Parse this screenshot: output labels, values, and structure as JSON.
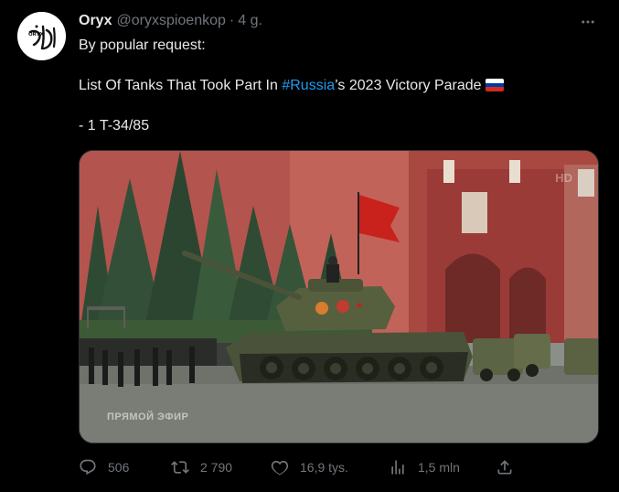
{
  "tweet": {
    "author": {
      "name": "Oryx",
      "handle": "@oryxspioenkop",
      "separator": "·",
      "time": "4 g.",
      "avatar_text": "ORYX"
    },
    "text": {
      "line1": "By popular request:",
      "line2_prefix": "List Of Tanks That Took Part In ",
      "hashtag": "#Russia",
      "line2_suffix": "’s 2023 Victory Parade",
      "line3": "- 1 T-34/85"
    },
    "flag_colors": [
      "#ffffff",
      "#0039a6",
      "#d52b1e"
    ],
    "media": {
      "overlay_text": "ПРЯМОЙ ЭФИР",
      "corner_text": "HD"
    },
    "actions": {
      "replies": "506",
      "retweets": "2 790",
      "likes": "16,9 tys.",
      "views": "1,5 mln"
    },
    "icons": [
      "more-icon",
      "reply-icon",
      "retweet-icon",
      "like-icon",
      "views-icon",
      "share-icon"
    ],
    "colors": {
      "background": "#000000",
      "text": "#e7e9ea",
      "muted": "#71767b",
      "link": "#1d9bf0"
    }
  }
}
